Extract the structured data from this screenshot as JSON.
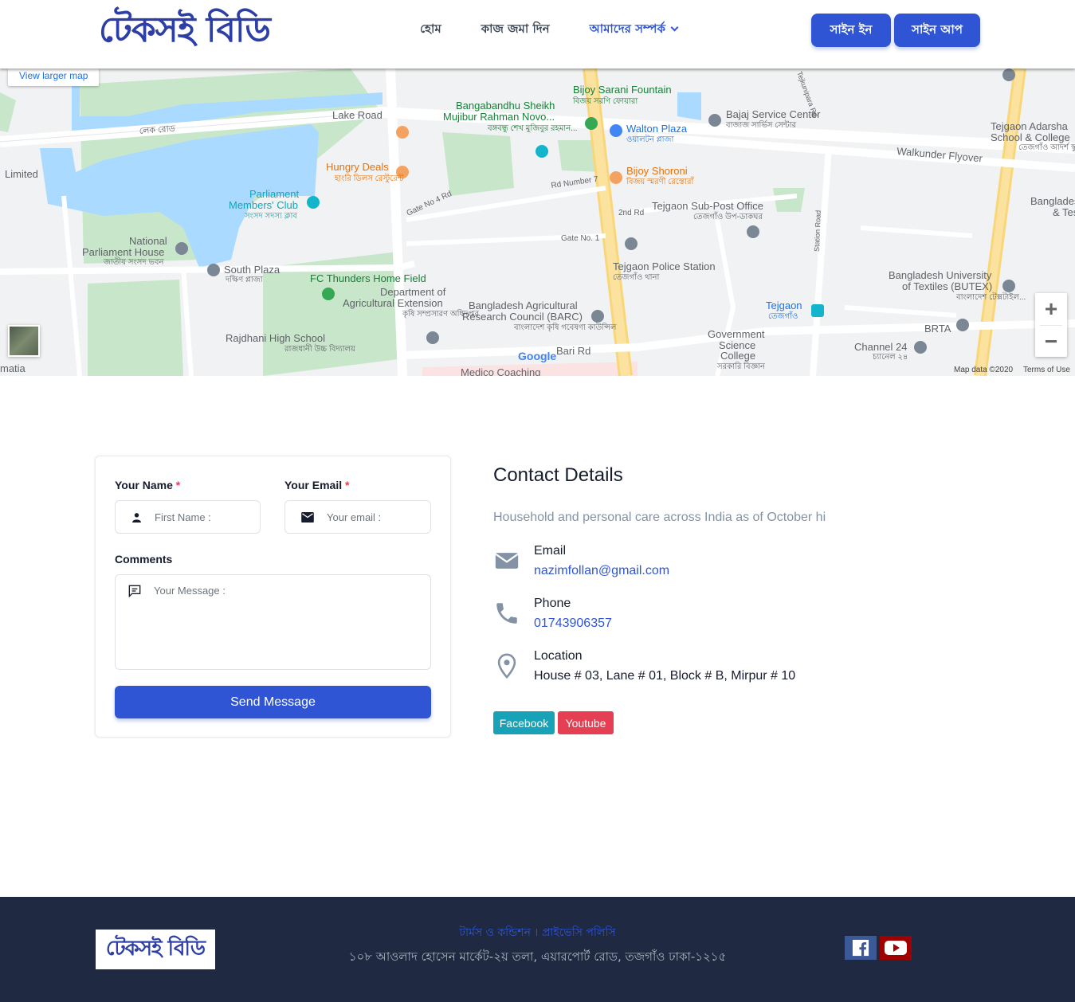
{
  "header": {
    "logo": "টেকসই বিডি",
    "nav": [
      "হোম",
      "কাজ জমা দিন",
      "আমাদের সম্পর্ক"
    ],
    "signin": "সাইন ইন",
    "signup": "সাইন আপ"
  },
  "map": {
    "view_larger": "View larger map",
    "zoom_in": "+",
    "zoom_out": "−",
    "labels": [
      "Lake Road",
      "লেক রোড",
      "Bijoy Sarani Fountain",
      "বিজয় সরণি ফোয়ারা",
      "Bangabandhu Sheikh",
      "Mujibur Rahman Novo...",
      "বঙ্গবন্ধু শেখ মুজিবুর রহমান...",
      "Walton Plaza",
      "ওয়ালটন প্লাজা",
      "Bajaj Service Center",
      "বাজাজ সার্ভিস সেন্টার",
      "Tejgaon Adarsha",
      "School & College",
      "তেজগাঁও আদর্শ স্কুল এন্ড কলেজ",
      "Walkunder Flyover",
      "Hungry Deals",
      "হাংরি ডিলস রেস্টুরেন্ট",
      "Rd Number 7",
      "Bijoy Shoroni",
      "বিজয় স্মরণী রেস্তোরাঁ",
      "Parliament",
      "Members' Club",
      "সংসদ সদস্য ক্লাব",
      "Gate No 4 Rd",
      "2nd Rd",
      "Tejgaon Sub-Post Office",
      "তেজগাঁও উপ-ডাকঘর",
      "Bangladesh",
      "& Test",
      "Limited",
      "National",
      "Parliament House",
      "জাতীয় সংসদ ভবন",
      "Gate No. 1",
      "South Plaza",
      "দক্ষিণ প্লাজা",
      "FC Thunders Home Field",
      "Department of",
      "Agricultural Extension",
      "কৃষি সম্প্রসারণ অধিদপ্তর",
      "Tejgaon Police Station",
      "তেজগাঁও থানা",
      "Bangladesh University",
      "of Textiles (BUTEX)",
      "বাংলাদেশ টেক্সটাইল...",
      "Bangladesh Agricultural",
      "Research Council (BARC)",
      "বাংলাদেশ কৃষি গবেষণা কাউন্সিল",
      "Tejgaon",
      "তেজগাঁও",
      "Rajdhani High School",
      "রাজধানী উচ্চ বিদ্যালয়",
      "Government",
      "Science",
      "College",
      "সরকারি বিজ্ঞান",
      "BRTA",
      "Channel 24",
      "চ্যানেল ২৪",
      "Bari Rd",
      "Medico Coaching",
      "matia",
      "Station Road",
      "Tejkunipara Rd"
    ],
    "google": "Google",
    "map_data": "Map data ©2020",
    "terms": "Terms of Use"
  },
  "form": {
    "name_label": "Your Name",
    "email_label": "Your Email",
    "required_mark": "*",
    "name_placeholder": "First Name :",
    "email_placeholder": "Your email :",
    "comments_label": "Comments",
    "message_placeholder": "Your Message :",
    "send_label": "Send Message"
  },
  "contact": {
    "title": "Contact Details",
    "description": "Household and personal care across India as of October hi",
    "email_label": "Email",
    "email_value": "nazimfollan@gmail.com",
    "phone_label": "Phone",
    "phone_value": "01743906357",
    "location_label": "Location",
    "location_value": "House # 03, Lane # 01, Block # B, Mirpur # 10",
    "facebook_label": "Facebook",
    "youtube_label": "Youtube"
  },
  "footer": {
    "logo": "টেকসই বিডি",
    "links": "টার্মস ও কন্ডিশন । প্রাইভেসি পলিসি",
    "address": "১০৮ আওলাদ হোসেন মার্কেট-২য় তলা, এয়ারপোর্ট রোড, তজগাঁও ঢাকা-১২১৫"
  }
}
